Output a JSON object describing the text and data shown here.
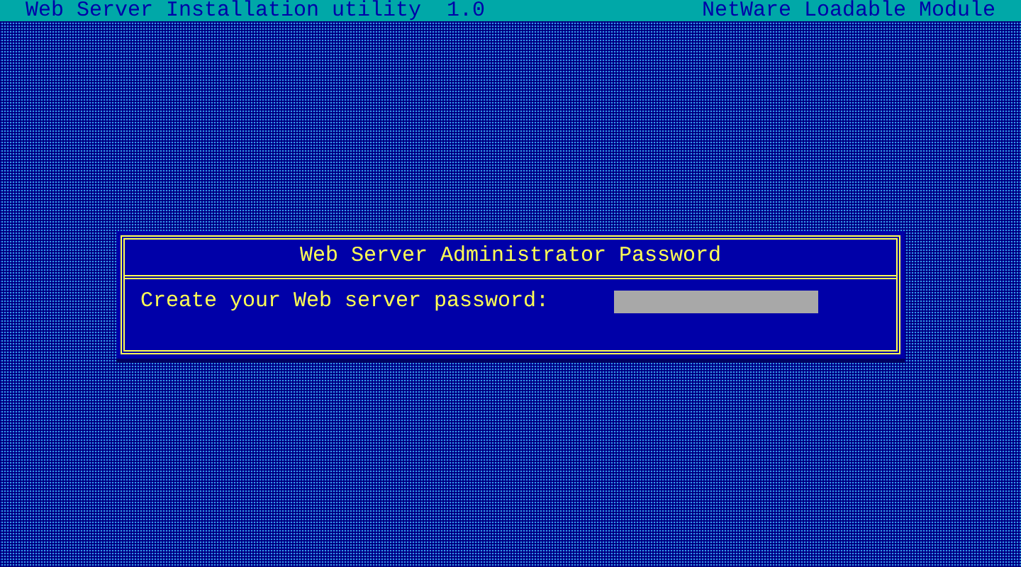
{
  "header": {
    "title": "Web Server Installation utility  1.0",
    "module": "NetWare Loadable Module"
  },
  "dialog": {
    "title": "Web Server Administrator Password",
    "field_label": "Create your Web server password:"
  }
}
